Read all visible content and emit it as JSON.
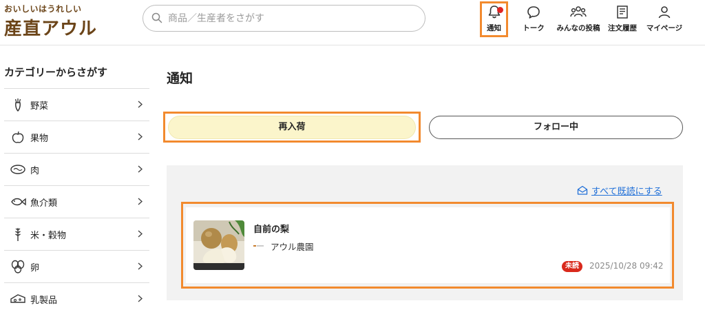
{
  "brand": {
    "tagline": "おいしいはうれしい",
    "name": "産直アウル",
    "color": "#6b4418"
  },
  "search": {
    "placeholder": "商品／生産者をさがす"
  },
  "nav": [
    {
      "label": "通知",
      "icon": "bell-icon",
      "has_unread_dot": true
    },
    {
      "label": "トーク",
      "icon": "chat-bubble-icon"
    },
    {
      "label": "みんなの投稿",
      "icon": "people-icon"
    },
    {
      "label": "注文履歴",
      "icon": "receipt-icon"
    },
    {
      "label": "マイページ",
      "icon": "user-icon"
    }
  ],
  "sidebar": {
    "title": "カテゴリーからさがす",
    "categories": [
      {
        "label": "野菜",
        "icon": "carrot-icon"
      },
      {
        "label": "果物",
        "icon": "apple-icon"
      },
      {
        "label": "肉",
        "icon": "meat-icon"
      },
      {
        "label": "魚介類",
        "icon": "fish-icon"
      },
      {
        "label": "米・穀物",
        "icon": "rice-plant-icon"
      },
      {
        "label": "卵",
        "icon": "egg-icon"
      },
      {
        "label": "乳製品",
        "icon": "cheese-icon"
      }
    ]
  },
  "main": {
    "title": "通知",
    "tabs": [
      {
        "label": "再入荷",
        "active": true
      },
      {
        "label": "フォロー中",
        "active": false
      }
    ],
    "mark_all_read": "すべて既読にする",
    "notifications": [
      {
        "product": "自前の梨",
        "shop": "アウル農園",
        "status": "未読",
        "datetime": "2025/10/28 09:42"
      }
    ]
  },
  "colors": {
    "highlight_outline": "#f28a2e",
    "active_tab_bg": "#fbf5cb",
    "unread_badge": "#d9291c",
    "link": "#1f6fd8",
    "notification_dot": "#e02424"
  }
}
